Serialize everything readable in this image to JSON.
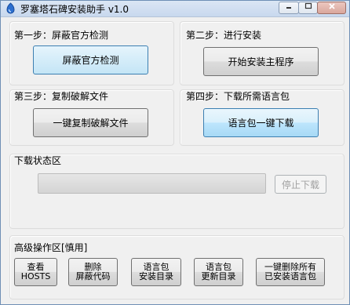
{
  "window": {
    "title": "罗塞塔石碑安装助手 v1.0"
  },
  "step1": {
    "label": "第一步：屏蔽官方检测",
    "button": "屏蔽官方检测"
  },
  "step2": {
    "label": "第二步：进行安装",
    "button": "开始安装主程序"
  },
  "step3": {
    "label": "第三步：复制破解文件",
    "button": "一键复制破解文件"
  },
  "step4": {
    "label": "第四步：下载所需语言包",
    "button": "语言包一键下载"
  },
  "download": {
    "label": "下载状态区",
    "progress": 0,
    "stop_button": "停止下载"
  },
  "advanced": {
    "label": "高级操作区[慎用]",
    "buttons": [
      {
        "line1": "查看",
        "line2": "HOSTS"
      },
      {
        "line1": "删除",
        "line2": "屏蔽代码"
      },
      {
        "line1": "语言包",
        "line2": "安装目录"
      },
      {
        "line1": "语言包",
        "line2": "更新目录"
      },
      {
        "line1": "一键删除所有",
        "line2": "已安装语言包"
      }
    ]
  }
}
